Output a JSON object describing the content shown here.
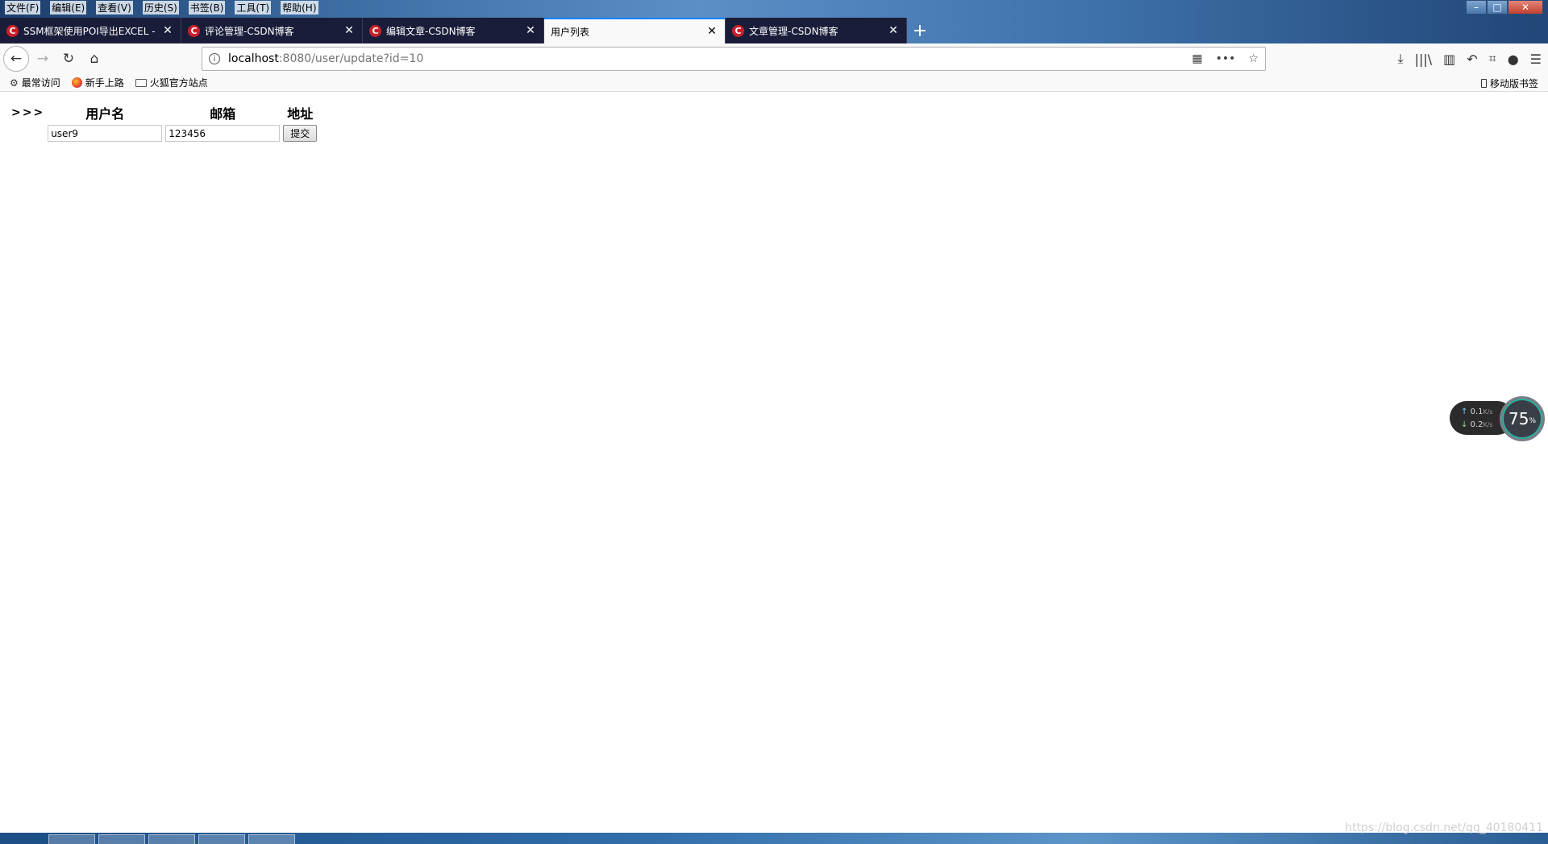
{
  "menubar": {
    "items": [
      "文件(F)",
      "编辑(E)",
      "查看(V)",
      "历史(S)",
      "书签(B)",
      "工具(T)",
      "帮助(H)"
    ]
  },
  "tabs": [
    {
      "title": "SSM框架使用POI导出EXCEL -",
      "active": false
    },
    {
      "title": "评论管理-CSDN博客",
      "active": false
    },
    {
      "title": "编辑文章-CSDN博客",
      "active": false
    },
    {
      "title": "用户列表",
      "active": true
    },
    {
      "title": "文章管理-CSDN博客",
      "active": false
    }
  ],
  "urlbar": {
    "host": "localhost",
    "path": ":8080/user/update?id=10"
  },
  "bookmarks": {
    "items": [
      "最常访问",
      "新手上路",
      "火狐官方站点"
    ],
    "mobile": "移动版书签"
  },
  "form": {
    "arrow": ">>>",
    "headers": [
      "用户名",
      "邮箱",
      "地址"
    ],
    "username_value": "user9",
    "email_value": "123456",
    "submit_label": "提交"
  },
  "netwidget": {
    "upload": "0.1",
    "download": "0.2",
    "unit": "K/s",
    "percent": "75",
    "percent_sign": "%"
  },
  "watermark": "https://blog.csdn.net/qq_40180411"
}
